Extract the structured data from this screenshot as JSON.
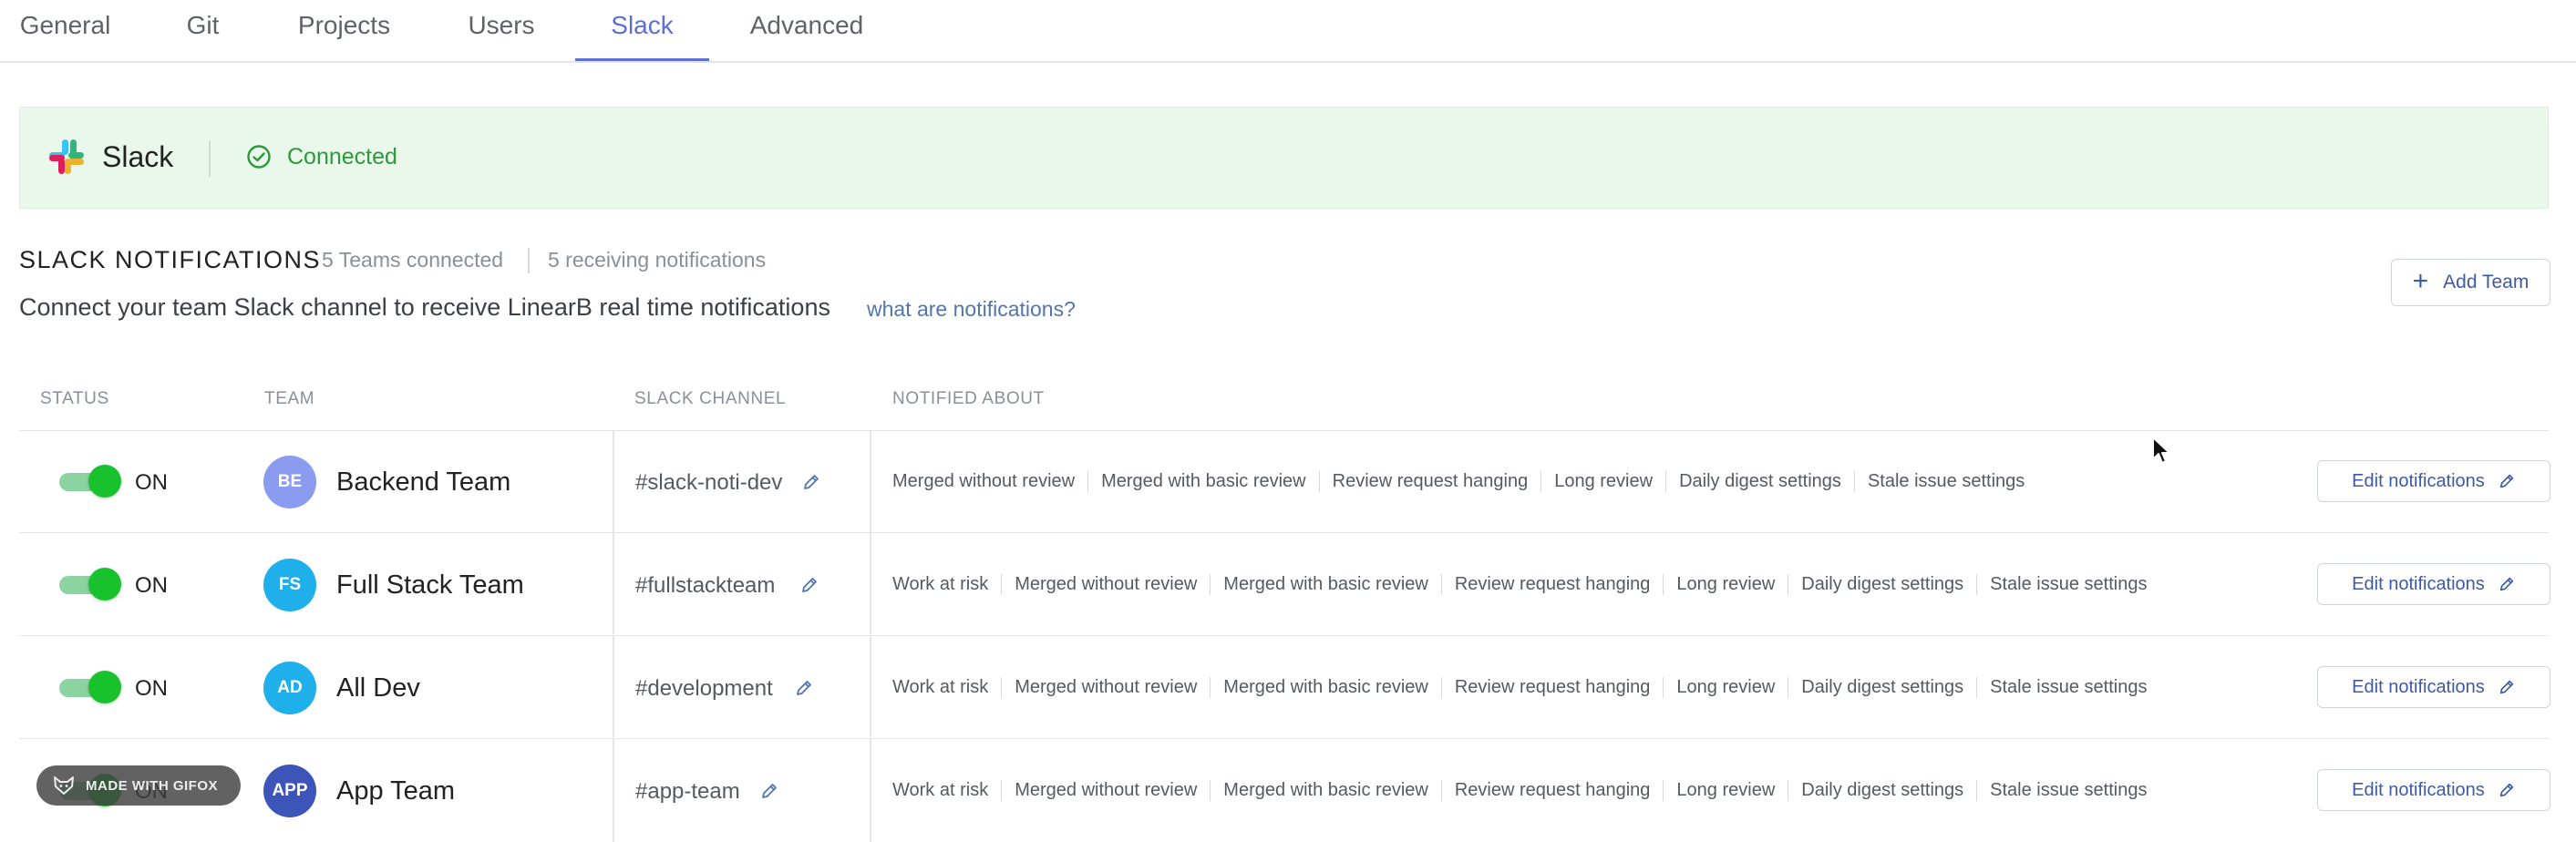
{
  "tabs": [
    {
      "label": "General"
    },
    {
      "label": "Git"
    },
    {
      "label": "Projects"
    },
    {
      "label": "Users"
    },
    {
      "label": "Slack",
      "active": true
    },
    {
      "label": "Advanced"
    }
  ],
  "banner": {
    "title": "Slack",
    "status": "Connected",
    "icon": "slack-logo",
    "status_icon": "check-circle-icon",
    "status_color": "#2b9a3c"
  },
  "section": {
    "title": "SLACK NOTIFICATIONS",
    "teams_connected": "5 Teams connected",
    "receiving": "5 receiving notifications",
    "description": "Connect your team Slack channel to receive LinearB real time notifications",
    "link": "what are notifications?",
    "add_team_label": "Add Team"
  },
  "table": {
    "headers": {
      "status": "STATUS",
      "team": "TEAM",
      "channel": "SLACK CHANNEL",
      "notified": "NOTIFIED ABOUT"
    },
    "rows": [
      {
        "status": "ON",
        "enabled": true,
        "avatar": "BE",
        "avatar_color": "#8b9cf0",
        "team": "Backend Team",
        "channel": "#slack-noti-dev",
        "notifications": [
          "Merged without review",
          "Merged with basic review",
          "Review request hanging",
          "Long review",
          "Daily digest settings",
          "Stale issue settings"
        ],
        "edit_label": "Edit notifications"
      },
      {
        "status": "ON",
        "enabled": true,
        "avatar": "FS",
        "avatar_color": "#1fb0ec",
        "team": "Full Stack Team",
        "channel": "#fullstackteam",
        "notifications": [
          "Work at risk",
          "Merged without review",
          "Merged with basic review",
          "Review request hanging",
          "Long review",
          "Daily digest settings",
          "Stale issue settings"
        ],
        "edit_label": "Edit notifications"
      },
      {
        "status": "ON",
        "enabled": true,
        "avatar": "AD",
        "avatar_color": "#1fb0ec",
        "team": "All Dev",
        "channel": "#development",
        "notifications": [
          "Work at risk",
          "Merged without review",
          "Merged with basic review",
          "Review request hanging",
          "Long review",
          "Daily digest settings",
          "Stale issue settings"
        ],
        "edit_label": "Edit notifications"
      },
      {
        "status": "ON",
        "enabled": true,
        "avatar": "APP",
        "avatar_color": "#3d54b8",
        "team": "App Team",
        "channel": "#app-team",
        "notifications": [
          "Work at risk",
          "Merged without review",
          "Merged with basic review",
          "Review request hanging",
          "Long review",
          "Daily digest settings",
          "Stale issue settings"
        ],
        "edit_label": "Edit notifications"
      }
    ]
  },
  "overlay": {
    "gifox_label": "MADE WITH GIFOX"
  },
  "colors": {
    "accent": "#5b6fd6",
    "toggle_on": "#18c22d",
    "banner_bg": "#e9f8ea",
    "link": "#5275b0"
  }
}
